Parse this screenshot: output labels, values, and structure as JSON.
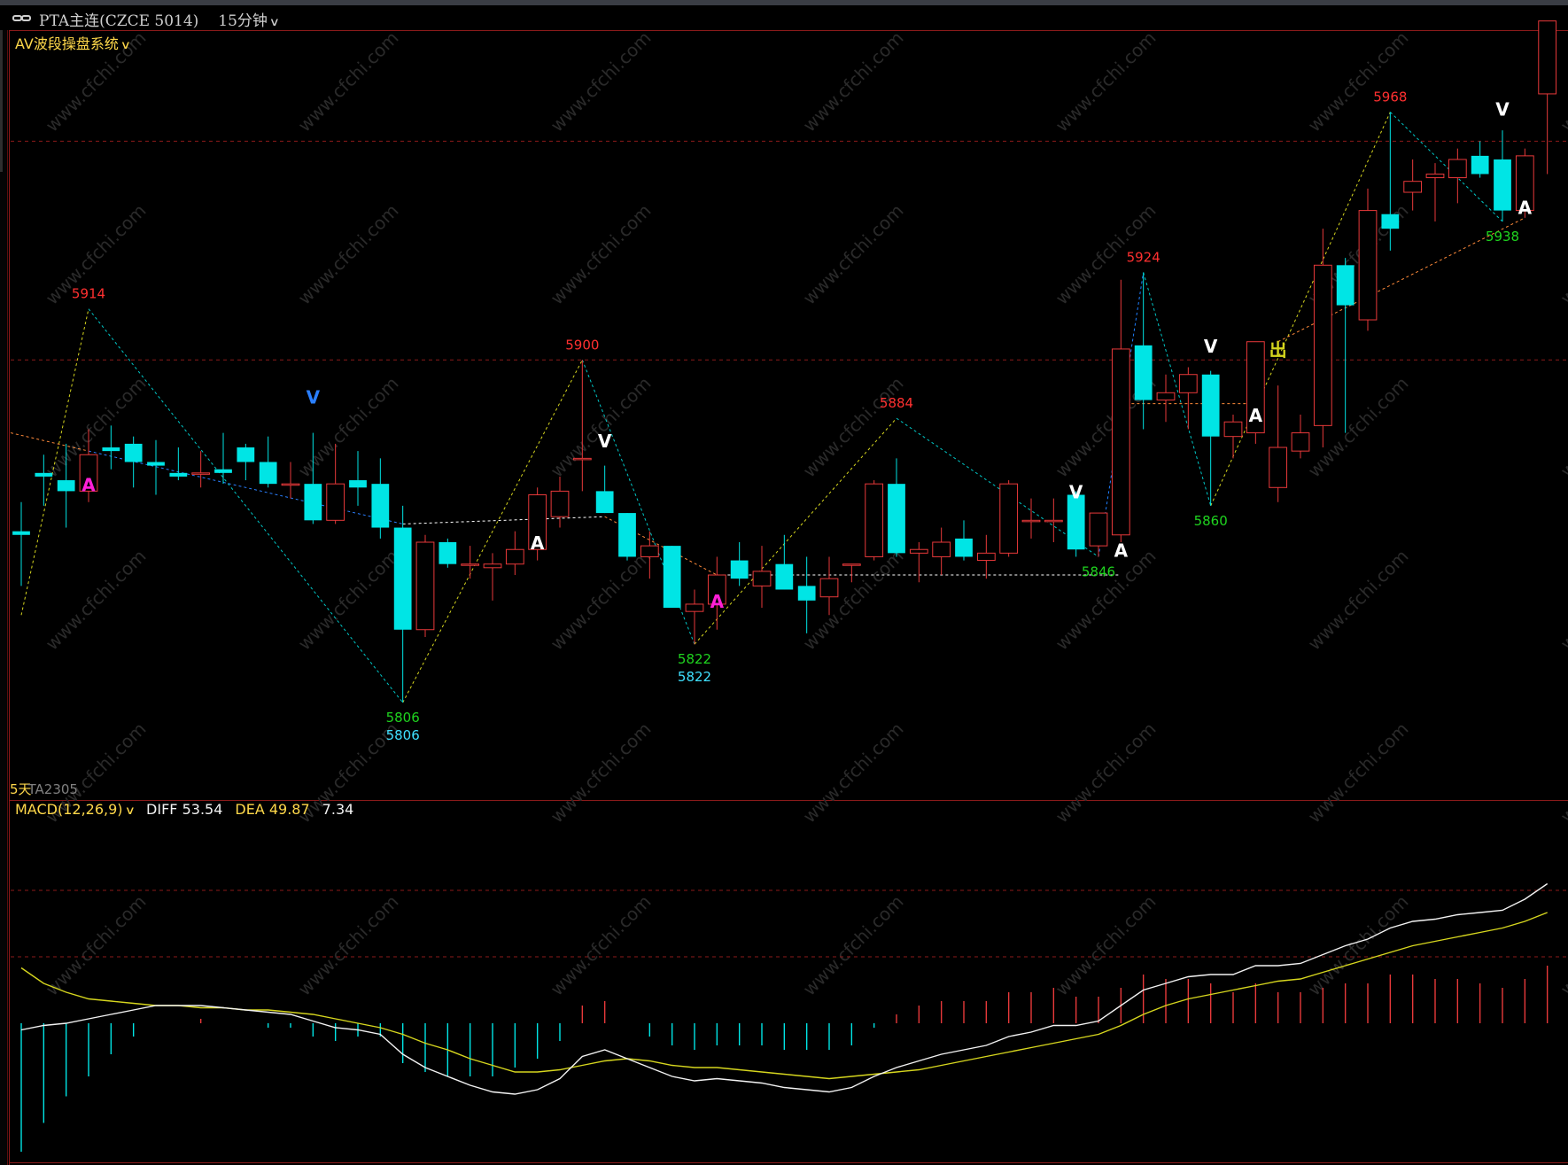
{
  "window": {
    "title": "PTA主连(CZCE 5014)",
    "period": "15分钟",
    "icon": "link-icon"
  },
  "main_panel": {
    "indicator_name": "AV波段操盘系统",
    "contract_days": "5天",
    "contract_code": "TA2305",
    "watermark": "www.cfchi.com"
  },
  "macd_panel": {
    "name": "MACD(12,26,9)",
    "diff_label": "DIFF",
    "diff_value": "53.54",
    "dea_label": "DEA",
    "dea_value": "49.87",
    "macd_value": "7.34"
  },
  "colors": {
    "up": "#e8393a",
    "down": "#00e5e5",
    "diff_line": "#f2f2f2",
    "dea_line": "#d6d61e",
    "grid": "#8b1a1a",
    "label_red": "#ff3030",
    "label_green": "#1fd41f",
    "label_cyan": "#3fe0ff",
    "marker_a_magenta": "#ff1fd6",
    "marker_white": "#ffffff",
    "marker_blue": "#2a7fff"
  },
  "chart_data": {
    "type": "candlestick",
    "ylim": [
      5780,
      5990
    ],
    "candles": [
      {
        "o": 5853,
        "h": 5861,
        "l": 5838,
        "c": 5852
      },
      {
        "o": 5869,
        "h": 5874,
        "l": 5860,
        "c": 5868
      },
      {
        "o": 5867,
        "h": 5877,
        "l": 5854,
        "c": 5864
      },
      {
        "o": 5864,
        "h": 5881,
        "l": 5861,
        "c": 5874
      },
      {
        "o": 5876,
        "h": 5882,
        "l": 5870,
        "c": 5875
      },
      {
        "o": 5877,
        "h": 5879,
        "l": 5865,
        "c": 5872
      },
      {
        "o": 5872,
        "h": 5878,
        "l": 5863,
        "c": 5871
      },
      {
        "o": 5869,
        "h": 5876,
        "l": 5867,
        "c": 5868
      },
      {
        "o": 5869,
        "h": 5875,
        "l": 5865,
        "c": 5869
      },
      {
        "o": 5870,
        "h": 5880,
        "l": 5866,
        "c": 5869
      },
      {
        "o": 5876,
        "h": 5877,
        "l": 5867,
        "c": 5872
      },
      {
        "o": 5872,
        "h": 5879,
        "l": 5865,
        "c": 5866
      },
      {
        "o": 5866,
        "h": 5872,
        "l": 5862,
        "c": 5866
      },
      {
        "o": 5866,
        "h": 5880,
        "l": 5855,
        "c": 5856
      },
      {
        "o": 5856,
        "h": 5877,
        "l": 5855,
        "c": 5866
      },
      {
        "o": 5867,
        "h": 5875,
        "l": 5860,
        "c": 5865
      },
      {
        "o": 5866,
        "h": 5873,
        "l": 5851,
        "c": 5854
      },
      {
        "o": 5854,
        "h": 5860,
        "l": 5806,
        "c": 5826
      },
      {
        "o": 5826,
        "h": 5852,
        "l": 5824,
        "c": 5850
      },
      {
        "o": 5850,
        "h": 5851,
        "l": 5843,
        "c": 5844
      },
      {
        "o": 5844,
        "h": 5849,
        "l": 5840,
        "c": 5844
      },
      {
        "o": 5843,
        "h": 5847,
        "l": 5834,
        "c": 5844
      },
      {
        "o": 5844,
        "h": 5853,
        "l": 5841,
        "c": 5848
      },
      {
        "o": 5848,
        "h": 5865,
        "l": 5845,
        "c": 5863
      },
      {
        "o": 5857,
        "h": 5868,
        "l": 5854,
        "c": 5864
      },
      {
        "o": 5873,
        "h": 5900,
        "l": 5864,
        "c": 5873
      },
      {
        "o": 5864,
        "h": 5871,
        "l": 5858,
        "c": 5858
      },
      {
        "o": 5858,
        "h": 5858,
        "l": 5845,
        "c": 5846
      },
      {
        "o": 5846,
        "h": 5853,
        "l": 5840,
        "c": 5849
      },
      {
        "o": 5849,
        "h": 5849,
        "l": 5832,
        "c": 5832
      },
      {
        "o": 5831,
        "h": 5837,
        "l": 5822,
        "c": 5833
      },
      {
        "o": 5833,
        "h": 5846,
        "l": 5826,
        "c": 5841
      },
      {
        "o": 5845,
        "h": 5850,
        "l": 5838,
        "c": 5840
      },
      {
        "o": 5838,
        "h": 5849,
        "l": 5832,
        "c": 5842
      },
      {
        "o": 5844,
        "h": 5852,
        "l": 5837,
        "c": 5837
      },
      {
        "o": 5838,
        "h": 5846,
        "l": 5825,
        "c": 5834
      },
      {
        "o": 5835,
        "h": 5846,
        "l": 5830,
        "c": 5840
      },
      {
        "o": 5844,
        "h": 5844,
        "l": 5839,
        "c": 5844
      },
      {
        "o": 5846,
        "h": 5867,
        "l": 5845,
        "c": 5866
      },
      {
        "o": 5866,
        "h": 5873,
        "l": 5846,
        "c": 5847
      },
      {
        "o": 5847,
        "h": 5850,
        "l": 5839,
        "c": 5848
      },
      {
        "o": 5846,
        "h": 5854,
        "l": 5841,
        "c": 5850
      },
      {
        "o": 5851,
        "h": 5856,
        "l": 5845,
        "c": 5846
      },
      {
        "o": 5845,
        "h": 5852,
        "l": 5840,
        "c": 5847
      },
      {
        "o": 5847,
        "h": 5867,
        "l": 5846,
        "c": 5866
      },
      {
        "o": 5856,
        "h": 5862,
        "l": 5851,
        "c": 5856
      },
      {
        "o": 5856,
        "h": 5862,
        "l": 5850,
        "c": 5856
      },
      {
        "o": 5863,
        "h": 5864,
        "l": 5846,
        "c": 5848
      },
      {
        "o": 5849,
        "h": 5856,
        "l": 5846,
        "c": 5858
      },
      {
        "o": 5852,
        "h": 5922,
        "l": 5850,
        "c": 5903
      },
      {
        "o": 5904,
        "h": 5924,
        "l": 5881,
        "c": 5889
      },
      {
        "o": 5889,
        "h": 5896,
        "l": 5883,
        "c": 5891
      },
      {
        "o": 5891,
        "h": 5898,
        "l": 5881,
        "c": 5896
      },
      {
        "o": 5896,
        "h": 5897,
        "l": 5860,
        "c": 5879
      },
      {
        "o": 5879,
        "h": 5885,
        "l": 5873,
        "c": 5883
      },
      {
        "o": 5880,
        "h": 5905,
        "l": 5877,
        "c": 5905
      },
      {
        "o": 5865,
        "h": 5893,
        "l": 5861,
        "c": 5876
      },
      {
        "o": 5875,
        "h": 5885,
        "l": 5873,
        "c": 5880
      },
      {
        "o": 5882,
        "h": 5936,
        "l": 5876,
        "c": 5926
      },
      {
        "o": 5926,
        "h": 5928,
        "l": 5880,
        "c": 5915
      },
      {
        "o": 5911,
        "h": 5947,
        "l": 5908,
        "c": 5941
      },
      {
        "o": 5940,
        "h": 5968,
        "l": 5930,
        "c": 5936
      },
      {
        "o": 5946,
        "h": 5955,
        "l": 5941,
        "c": 5949
      },
      {
        "o": 5950,
        "h": 5954,
        "l": 5938,
        "c": 5951
      },
      {
        "o": 5950,
        "h": 5958,
        "l": 5943,
        "c": 5955
      },
      {
        "o": 5956,
        "h": 5960,
        "l": 5950,
        "c": 5951
      },
      {
        "o": 5955,
        "h": 5963,
        "l": 5938,
        "c": 5941
      },
      {
        "o": 5941,
        "h": 5958,
        "l": 5939,
        "c": 5956
      },
      {
        "o": 5973,
        "h": 5983,
        "l": 5951,
        "c": 5993
      }
    ],
    "price_labels": [
      {
        "text": "5914",
        "i": 3,
        "price": 5914,
        "color": "label_red",
        "pos": "above"
      },
      {
        "text": "5900",
        "i": 25,
        "price": 5900,
        "color": "label_red",
        "pos": "above"
      },
      {
        "text": "5884",
        "i": 39,
        "price": 5884,
        "color": "label_red",
        "pos": "above"
      },
      {
        "text": "5924",
        "i": 50,
        "price": 5924,
        "color": "label_red",
        "pos": "above"
      },
      {
        "text": "5968",
        "i": 61,
        "price": 5968,
        "color": "label_red",
        "pos": "above"
      },
      {
        "text": "5806",
        "i": 17,
        "price": 5806,
        "color": "label_green",
        "pos": "below"
      },
      {
        "text": "5806",
        "i": 17,
        "price": 5806,
        "color": "label_cyan",
        "pos": "below2"
      },
      {
        "text": "5822",
        "i": 30,
        "price": 5822,
        "color": "label_green",
        "pos": "below"
      },
      {
        "text": "5822",
        "i": 30,
        "price": 5822,
        "color": "label_cyan",
        "pos": "below2"
      },
      {
        "text": "5846",
        "i": 48,
        "price": 5846,
        "color": "label_green",
        "pos": "below"
      },
      {
        "text": "5860",
        "i": 53,
        "price": 5860,
        "color": "label_green",
        "pos": "below"
      },
      {
        "text": "5938",
        "i": 66,
        "price": 5938,
        "color": "label_green",
        "pos": "below"
      }
    ],
    "markers": [
      {
        "text": "A",
        "i": 3,
        "price": 5864,
        "color": "marker_a_magenta"
      },
      {
        "text": "V",
        "i": 13,
        "price": 5888,
        "color": "marker_blue"
      },
      {
        "text": "A",
        "i": 23,
        "price": 5848,
        "color": "marker_white"
      },
      {
        "text": "V",
        "i": 26,
        "price": 5876,
        "color": "marker_white"
      },
      {
        "text": "A",
        "i": 31,
        "price": 5832,
        "color": "marker_magenta"
      },
      {
        "text": "V",
        "i": 47,
        "price": 5862,
        "color": "marker_white"
      },
      {
        "text": "A",
        "i": 49,
        "price": 5846,
        "color": "marker_white"
      },
      {
        "text": "V",
        "i": 53,
        "price": 5902,
        "color": "marker_white"
      },
      {
        "text": "A",
        "i": 55,
        "price": 5883,
        "color": "marker_white"
      },
      {
        "text": "出",
        "i": 56,
        "price": 5901,
        "color": "dea_line"
      },
      {
        "text": "V",
        "i": 66,
        "price": 5967,
        "color": "marker_white"
      },
      {
        "text": "A",
        "i": 67,
        "price": 5940,
        "color": "marker_white"
      }
    ],
    "macd": {
      "ylim": [
        -60,
        90
      ],
      "diff": [
        -3,
        -1,
        0,
        2,
        4,
        6,
        8,
        8,
        8,
        7,
        6,
        5,
        4,
        1,
        -2,
        -3,
        -5,
        -14,
        -20,
        -24,
        -28,
        -31,
        -32,
        -30,
        -25,
        -15,
        -12,
        -16,
        -20,
        -24,
        -26,
        -25,
        -26,
        -27,
        -29,
        -30,
        -31,
        -29,
        -24,
        -20,
        -17,
        -14,
        -12,
        -10,
        -6,
        -4,
        -1,
        -1,
        1,
        8,
        15,
        18,
        21,
        22,
        22,
        26,
        26,
        27,
        31,
        35,
        38,
        43,
        46,
        47,
        49,
        50,
        51,
        56,
        63
      ],
      "dea": [
        25,
        18,
        14,
        11,
        10,
        9,
        8,
        8,
        7,
        7,
        6,
        6,
        5,
        4,
        2,
        0,
        -2,
        -5,
        -9,
        -12,
        -16,
        -19,
        -22,
        -22,
        -21,
        -19,
        -17,
        -16,
        -17,
        -19,
        -20,
        -20,
        -21,
        -22,
        -23,
        -24,
        -25,
        -24,
        -23,
        -22,
        -21,
        -19,
        -17,
        -15,
        -13,
        -11,
        -9,
        -7,
        -5,
        -1,
        4,
        8,
        11,
        13,
        15,
        17,
        19,
        20,
        23,
        26,
        29,
        32,
        35,
        37,
        39,
        41,
        43,
        46,
        50
      ],
      "hist": [
        -58,
        -45,
        -33,
        -24,
        -14,
        -6,
        0,
        0,
        2,
        0,
        0,
        -2,
        -2,
        -6,
        -8,
        -6,
        -6,
        -18,
        -22,
        -24,
        -24,
        -24,
        -20,
        -16,
        -8,
        8,
        10,
        0,
        -6,
        -10,
        -12,
        -10,
        -10,
        -10,
        -12,
        -12,
        -12,
        -10,
        -2,
        4,
        8,
        10,
        10,
        10,
        14,
        14,
        16,
        12,
        12,
        16,
        22,
        20,
        20,
        18,
        14,
        18,
        14,
        14,
        16,
        18,
        18,
        22,
        22,
        20,
        20,
        18,
        16,
        20,
        26
      ]
    }
  }
}
